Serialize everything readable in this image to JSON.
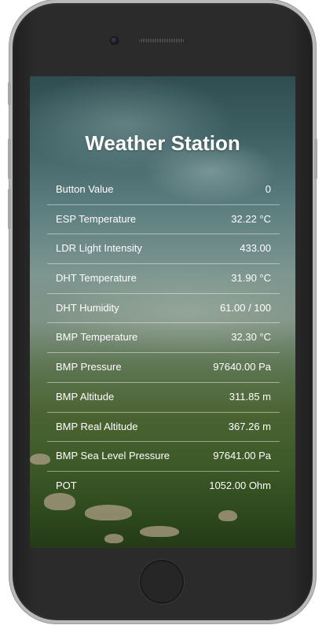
{
  "page": {
    "title": "Weather Station"
  },
  "readings": [
    {
      "label": "Button Value",
      "value": "0"
    },
    {
      "label": "ESP Temperature",
      "value": "32.22 °C"
    },
    {
      "label": "LDR Light Intensity",
      "value": "433.00"
    },
    {
      "label": "DHT Temperature",
      "value": "31.90 °C"
    },
    {
      "label": "DHT Humidity",
      "value": "61.00 / 100"
    },
    {
      "label": "BMP Temperature",
      "value": "32.30 °C"
    },
    {
      "label": "BMP Pressure",
      "value": "97640.00 Pa"
    },
    {
      "label": "BMP Altitude",
      "value": "311.85 m"
    },
    {
      "label": "BMP Real Altitude",
      "value": "367.26 m"
    },
    {
      "label": "BMP Sea Level Pressure",
      "value": "97641.00 Pa"
    },
    {
      "label": "POT",
      "value": "1052.00 Ohm"
    }
  ],
  "colors": {
    "text": "#ffffff",
    "phone_frame": "#2b2b2b",
    "phone_bezel": "#b9b9b9"
  }
}
